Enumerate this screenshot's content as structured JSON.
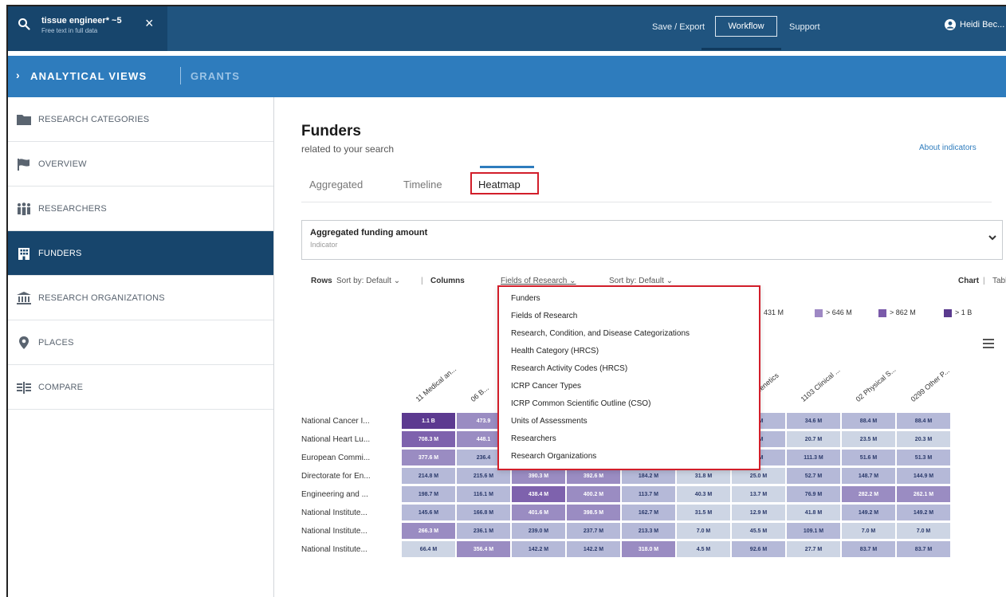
{
  "topbar": {
    "search_query": "tissue engineer* ~5",
    "search_sub": "Free text in full data",
    "save_export": "Save / Export",
    "workflow": "Workflow",
    "support": "Support",
    "user": "Heidi Bec..."
  },
  "analytical_bar": {
    "title": "ANALYTICAL VIEWS",
    "grants": "GRANTS"
  },
  "sidebar": {
    "items": [
      {
        "label": "RESEARCH CATEGORIES",
        "icon": "folder-icon"
      },
      {
        "label": "OVERVIEW",
        "icon": "flag-icon"
      },
      {
        "label": "RESEARCHERS",
        "icon": "people-icon"
      },
      {
        "label": "FUNDERS",
        "icon": "building-icon"
      },
      {
        "label": "RESEARCH ORGANIZATIONS",
        "icon": "institution-icon"
      },
      {
        "label": "PLACES",
        "icon": "location-pin-icon"
      },
      {
        "label": "COMPARE",
        "icon": "compare-icon"
      }
    ],
    "active_index": 3
  },
  "main": {
    "title": "Funders",
    "subtitle": "related to your search",
    "about": "About indicators",
    "tabs": [
      "Aggregated",
      "Timeline",
      "Heatmap"
    ],
    "active_tab": "Heatmap",
    "indicator_title": "Aggregated funding amount",
    "indicator_sub": "Indicator",
    "controls": {
      "rows": "Rows",
      "rows_sort": "Sort by: Default",
      "columns": "Columns",
      "columns_field": "Fields of Research",
      "columns_sort": "Sort by: Default",
      "chart": "Chart",
      "sep": "|",
      "table": "Table"
    },
    "legend": [
      {
        "label": "431 M",
        "color": ""
      },
      {
        "label": "> 646 M",
        "color": "#9e88c4"
      },
      {
        "label": "> 862 M",
        "color": "#7a5aaa"
      },
      {
        "label": "> 1 B",
        "color": "#5a3a8e"
      }
    ]
  },
  "dropdown": {
    "items": [
      "Funders",
      "Fields of Research",
      "Research, Condition, and Disease Categorizations",
      "Health Category (HRCS)",
      "Research Activity Codes (HRCS)",
      "ICRP Cancer Types",
      "ICRP Common Scientific Outline (CSO)",
      "Units of Assessments",
      "Researchers",
      "Research Organizations"
    ]
  },
  "heatmap": {
    "columns": [
      "11 Medical an...",
      "06 B...",
      "",
      "",
      "",
      "",
      "...4 Genetics",
      "1103 Clinical ...",
      "02 Physical S...",
      "0299 Other P..."
    ],
    "rows": [
      {
        "label": "National Cancer I...",
        "cells": [
          "1.1 B",
          "473.9",
          "",
          "",
          "",
          "",
          "...M",
          "34.6 M",
          "88.4 M",
          "88.4 M"
        ],
        "levels": [
          4,
          2,
          0,
          0,
          0,
          0,
          1,
          1,
          1,
          1
        ]
      },
      {
        "label": "National Heart Lu...",
        "cells": [
          "708.3 M",
          "448.1",
          "",
          "",
          "",
          "",
          "...M",
          "20.7 M",
          "23.5 M",
          "20.3 M"
        ],
        "levels": [
          3,
          2,
          0,
          0,
          0,
          0,
          1,
          0,
          0,
          0
        ]
      },
      {
        "label": "European Commi...",
        "cells": [
          "377.6 M",
          "236.4",
          "",
          "",
          "",
          "",
          "...M",
          "111.3 M",
          "51.6 M",
          "51.3 M"
        ],
        "levels": [
          2,
          1,
          0,
          0,
          0,
          0,
          1,
          1,
          1,
          1
        ]
      },
      {
        "label": "Directorate for En...",
        "cells": [
          "214.8 M",
          "215.6 M",
          "390.3 M",
          "392.6 M",
          "184.2 M",
          "31.8 M",
          "25.0 M",
          "52.7 M",
          "148.7 M",
          "144.9 M"
        ],
        "levels": [
          1,
          1,
          2,
          2,
          1,
          0,
          0,
          1,
          1,
          1
        ]
      },
      {
        "label": "Engineering and ...",
        "cells": [
          "198.7 M",
          "116.1 M",
          "438.4 M",
          "400.2 M",
          "113.7 M",
          "40.3 M",
          "13.7 M",
          "76.9 M",
          "282.2 M",
          "262.1 M"
        ],
        "levels": [
          1,
          1,
          3,
          2,
          1,
          0,
          0,
          1,
          2,
          2
        ]
      },
      {
        "label": "National Institute...",
        "cells": [
          "145.6 M",
          "166.8 M",
          "401.6 M",
          "398.5 M",
          "162.7 M",
          "31.5 M",
          "12.9 M",
          "41.8 M",
          "149.2 M",
          "149.2 M"
        ],
        "levels": [
          1,
          1,
          2,
          2,
          1,
          0,
          0,
          0,
          1,
          1
        ]
      },
      {
        "label": "National Institute...",
        "cells": [
          "266.3 M",
          "236.1 M",
          "239.0 M",
          "237.7 M",
          "213.3 M",
          "7.0 M",
          "45.5 M",
          "109.1 M",
          "7.0 M",
          "7.0 M"
        ],
        "levels": [
          2,
          1,
          1,
          1,
          1,
          0,
          0,
          1,
          0,
          0
        ]
      },
      {
        "label": "National Institute...",
        "cells": [
          "66.4 M",
          "356.4 M",
          "142.2 M",
          "142.2 M",
          "318.0 M",
          "4.5 M",
          "92.6 M",
          "27.7 M",
          "83.7 M",
          "83.7 M"
        ],
        "levels": [
          0,
          2,
          1,
          1,
          2,
          0,
          1,
          0,
          1,
          1
        ]
      }
    ],
    "level_colors": [
      "#cdd5e4",
      "#b5b9d8",
      "#9a8cc2",
      "#7e62ad",
      "#5c3a90"
    ],
    "level_text_colors": [
      "#2b3a6b",
      "#2b3a6b",
      "#fff",
      "#fff",
      "#fff"
    ]
  }
}
